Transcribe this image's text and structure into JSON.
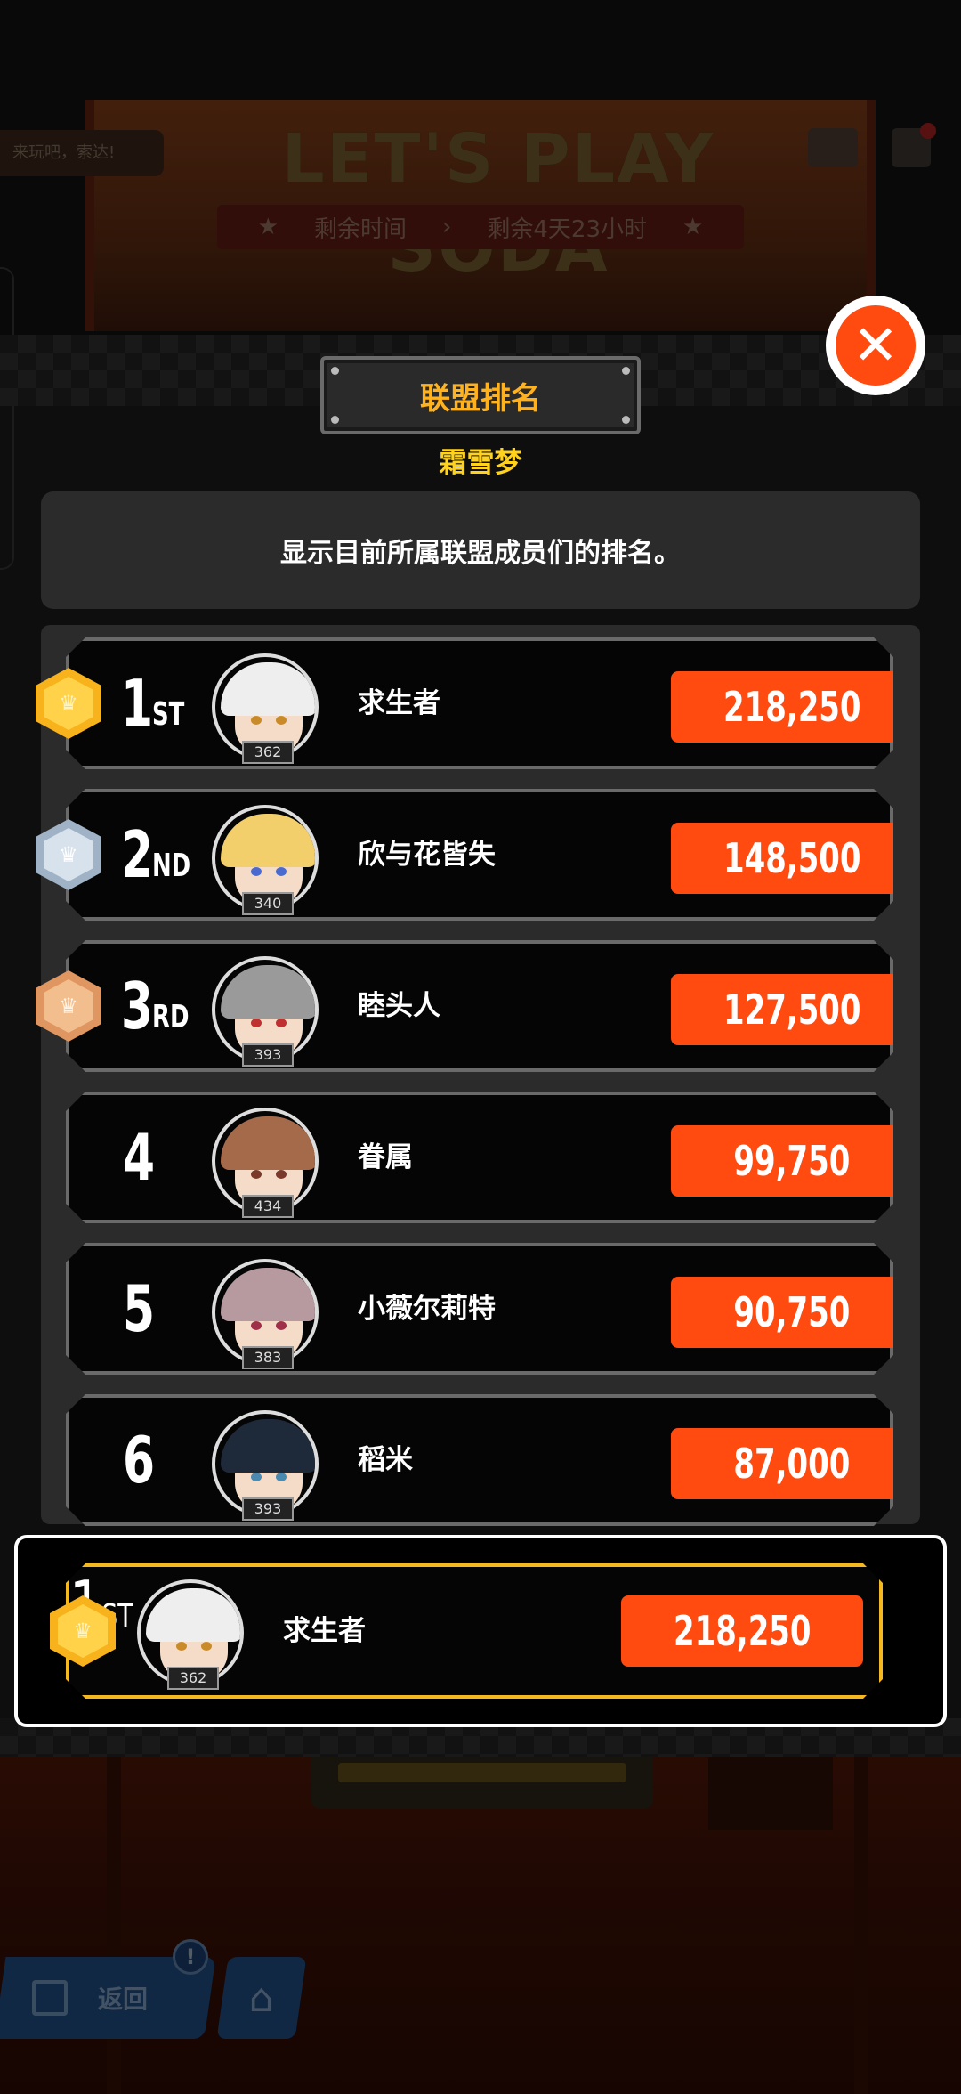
{
  "background": {
    "event_title": "LET'S PLAY SODA",
    "chat_text": "来玩吧，索达!",
    "timer_label": "剩余时间",
    "timer_value": "剩余4天23小时",
    "back_label": "返回",
    "notice_badge": "!"
  },
  "modal": {
    "title": "联盟排名",
    "union_name": "霜雪梦",
    "description": "显示目前所属联盟成员们的排名。",
    "close_icon": "close-x-icon"
  },
  "rankings": [
    {
      "rank": "1",
      "suffix": "ST",
      "medal": "gold",
      "name": "求生者",
      "level": "362",
      "score": "218,250",
      "hair": "#eeeeee",
      "eye": "#c98a2a"
    },
    {
      "rank": "2",
      "suffix": "ND",
      "medal": "silver",
      "name": "欣与花皆失",
      "level": "340",
      "score": "148,500",
      "hair": "#f2cf6a",
      "eye": "#4a6ad0"
    },
    {
      "rank": "3",
      "suffix": "RD",
      "medal": "bronze",
      "name": "睦头人",
      "level": "393",
      "score": "127,500",
      "hair": "#9a9a9a",
      "eye": "#c03030"
    },
    {
      "rank": "4",
      "suffix": "",
      "medal": "",
      "name": "眷属",
      "level": "434",
      "score": "99,750",
      "hair": "#a56a4a",
      "eye": "#7a3a2a"
    },
    {
      "rank": "5",
      "suffix": "",
      "medal": "",
      "name": "小薇尔莉特",
      "level": "383",
      "score": "90,750",
      "hair": "#b79aa0",
      "eye": "#a0304a"
    },
    {
      "rank": "6",
      "suffix": "",
      "medal": "",
      "name": "稻米",
      "level": "393",
      "score": "87,000",
      "hair": "#1e2a3a",
      "eye": "#4a8ab0"
    }
  ],
  "my_rank": {
    "rank": "1",
    "suffix": "ST",
    "medal": "gold",
    "name": "求生者",
    "level": "362",
    "score": "218,250",
    "hair": "#eeeeee",
    "eye": "#c98a2a"
  },
  "colors": {
    "accent_orange": "#ff4a10",
    "gold": "#ffb21e",
    "union_name": "#ffd21e"
  }
}
